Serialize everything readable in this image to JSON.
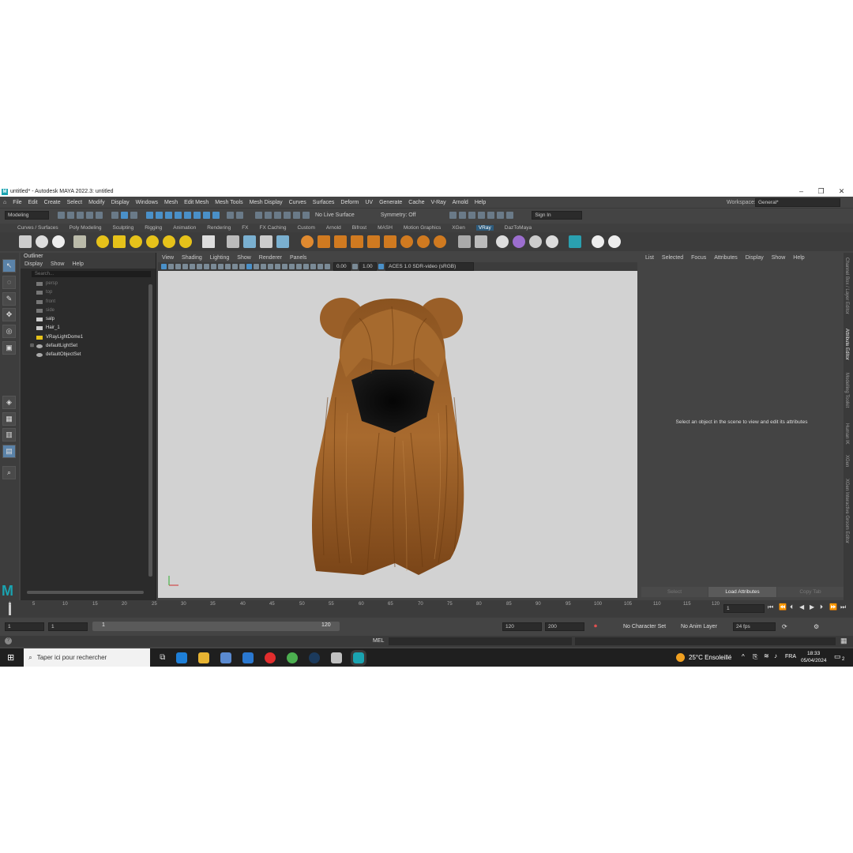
{
  "window": {
    "title": "untitled* - Autodesk MAYA 2022.3: untitled",
    "minimize": "–",
    "restore": "❐",
    "close": "✕"
  },
  "menubar": {
    "items": [
      "File",
      "Edit",
      "Create",
      "Select",
      "Modify",
      "Display",
      "Windows",
      "Mesh",
      "Edit Mesh",
      "Mesh Tools",
      "Mesh Display",
      "Curves",
      "Surfaces",
      "Deform",
      "UV",
      "Generate",
      "Cache",
      "V-Ray",
      "Arnold",
      "Help"
    ],
    "workspace_label": "Workspace:",
    "workspace_value": "General*"
  },
  "statusline": {
    "mode": "Modeling",
    "live_surface": "No Live Surface",
    "symmetry": "Symmetry: Off",
    "sign_in": "Sign In"
  },
  "shelf_tabs": [
    "Curves / Surfaces",
    "Poly Modeling",
    "Sculpting",
    "Rigging",
    "Animation",
    "Rendering",
    "FX",
    "FX Caching",
    "Custom",
    "Arnold",
    "Bifrost",
    "MASH",
    "Motion Graphics",
    "XGen",
    "VRay",
    "DazToMaya"
  ],
  "shelf_active": "VRay",
  "outliner": {
    "title": "Outliner",
    "menu": [
      "Display",
      "Show",
      "Help"
    ],
    "search_placeholder": "Search...",
    "items": [
      {
        "label": "persp",
        "dim": true
      },
      {
        "label": "top",
        "dim": true
      },
      {
        "label": "front",
        "dim": true
      },
      {
        "label": "side",
        "dim": true
      },
      {
        "label": "salp",
        "dim": false
      },
      {
        "label": "Hair_1",
        "dim": false
      },
      {
        "label": "VRayLightDome1",
        "dim": false
      },
      {
        "label": "defaultLightSet",
        "dim": false
      },
      {
        "label": "defaultObjectSet",
        "dim": false
      }
    ]
  },
  "viewport": {
    "menu": [
      "View",
      "Shading",
      "Lighting",
      "Show",
      "Renderer",
      "Panels"
    ],
    "exposure": "0.00",
    "gamma": "1.00",
    "color_space": "ACES 1.0 SDR-video (sRGB)"
  },
  "attribute_editor": {
    "menu": [
      "List",
      "Selected",
      "Focus",
      "Attributes",
      "Display",
      "Show",
      "Help"
    ],
    "message": "Select an object in the scene to view and edit its attributes",
    "buttons": [
      "Select",
      "Load Attributes",
      "Copy Tab"
    ]
  },
  "side_tabs": [
    "Channel Box / Layer Editor",
    "Attribute Editor",
    "Modelling Toolkit",
    "Human IK",
    "XGen",
    "XGen Interactive Groom Editor"
  ],
  "timeline": {
    "ticks": [
      "1",
      "5",
      "10",
      "15",
      "20",
      "25",
      "30",
      "35",
      "40",
      "45",
      "50",
      "55",
      "60",
      "65",
      "70",
      "75",
      "80",
      "85",
      "90",
      "95",
      "100",
      "105",
      "110",
      "115",
      "120"
    ],
    "current_frame": "1"
  },
  "range": {
    "start": "1",
    "playback_start": "1",
    "slider_start": "1",
    "slider_end": "120",
    "playback_end": "120",
    "end": "200",
    "character_set": "No Character Set",
    "anim_layer": "No Anim Layer",
    "fps": "24 fps"
  },
  "command_line": {
    "label": "MEL"
  },
  "taskbar": {
    "search": "Taper ici pour rechercher",
    "weather": "25°C  Ensoleillé",
    "lang": "FRA",
    "time": "18:33",
    "date": "05/04/2024",
    "notifications": "2"
  }
}
